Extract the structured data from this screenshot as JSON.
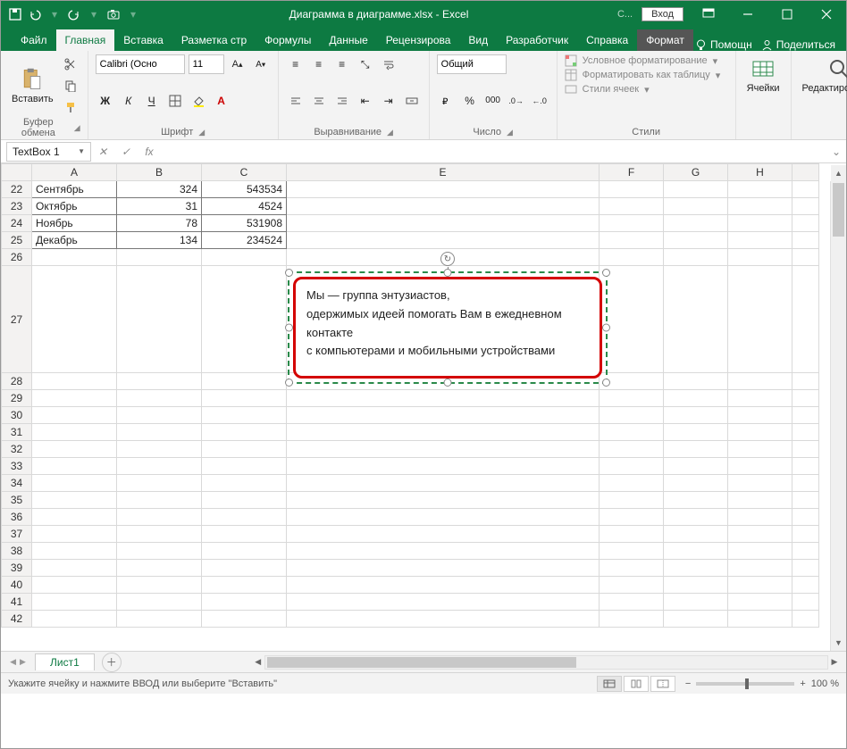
{
  "titlebar": {
    "filename_app": "Диаграмма в диаграмме.xlsx  -  Excel",
    "score_label": "С...",
    "signin": "Вход"
  },
  "tabs": {
    "file": "Файл",
    "home": "Главная",
    "insert": "Вставка",
    "pagelayout": "Разметка стр",
    "formulas": "Формулы",
    "data": "Данные",
    "review": "Рецензирова",
    "view": "Вид",
    "developer": "Разработчик",
    "help": "Справка",
    "format": "Формат",
    "tell_me": "Помощн",
    "share": "Поделиться"
  },
  "ribbon": {
    "clipboard": {
      "paste": "Вставить",
      "group": "Буфер обмена"
    },
    "font": {
      "name": "Calibri (Осно",
      "size": "11",
      "bold": "Ж",
      "italic": "К",
      "underline": "Ч",
      "group": "Шрифт"
    },
    "alignment": {
      "group": "Выравнивание"
    },
    "number": {
      "format": "Общий",
      "group": "Число"
    },
    "styles": {
      "conditional": "Условное форматирование",
      "table": "Форматировать как таблицу",
      "cellstyles": "Стили ячеек",
      "group": "Стили"
    },
    "cells": {
      "label": "Ячейки"
    },
    "editing": {
      "label": "Редактирование"
    }
  },
  "namebox": "TextBox 1",
  "formula": "",
  "columns": [
    "A",
    "B",
    "C",
    "E",
    "F",
    "G",
    "H"
  ],
  "rows_start": 22,
  "rows": [
    {
      "n": 22,
      "a": "Сентябрь",
      "b": "324",
      "c": "543534"
    },
    {
      "n": 23,
      "a": "Октябрь",
      "b": "31",
      "c": "4524"
    },
    {
      "n": 24,
      "a": "Ноябрь",
      "b": "78",
      "c": "531908"
    },
    {
      "n": 25,
      "a": "Декабрь",
      "b": "134",
      "c": "234524"
    }
  ],
  "empty_rows": [
    26,
    27,
    28,
    29,
    30,
    31,
    32,
    33,
    34,
    35,
    36,
    37,
    38,
    39,
    40,
    41,
    42
  ],
  "textbox": {
    "line1": "Мы — группа энтузиастов,",
    "line2": "одержимых идеей помогать Вам в ежедневном",
    "line3": "контакте",
    "line4": "с компьютерами и мобильными устройствами"
  },
  "sheet_tab": "Лист1",
  "statusbar": {
    "msg": "Укажите ячейку и нажмите ВВОД или выберите \"Вставить\"",
    "zoom": "100 %"
  }
}
